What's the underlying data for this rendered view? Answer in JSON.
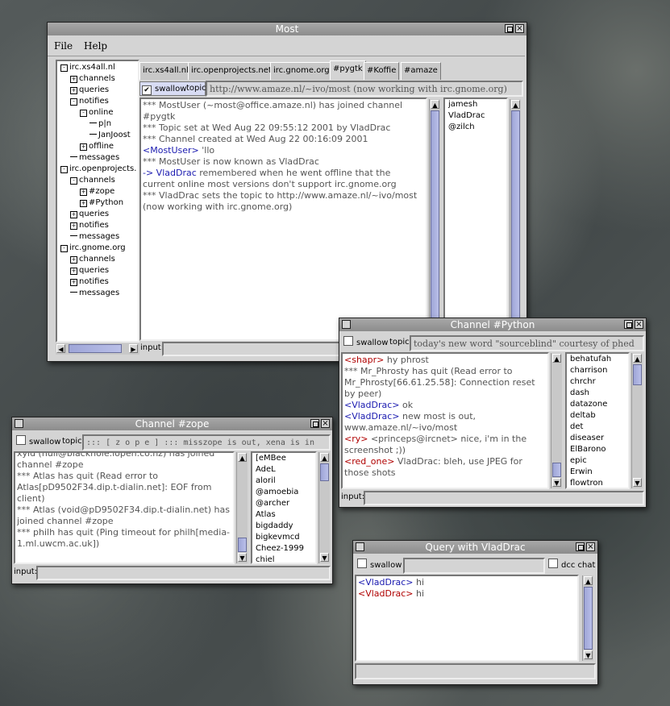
{
  "main": {
    "title": "Most",
    "menu": [
      "File",
      "Help"
    ],
    "tree": [
      {
        "label": "irc.xs4all.nl",
        "level": 0,
        "exp": "-"
      },
      {
        "label": "channels",
        "level": 1,
        "exp": "+"
      },
      {
        "label": "queries",
        "level": 1,
        "exp": "+"
      },
      {
        "label": "notifies",
        "level": 1,
        "exp": "-"
      },
      {
        "label": "online",
        "level": 2,
        "exp": "-"
      },
      {
        "label": "p|n",
        "level": 3,
        "exp": ""
      },
      {
        "label": "JanJoost",
        "level": 3,
        "exp": ""
      },
      {
        "label": "offline",
        "level": 2,
        "exp": "+"
      },
      {
        "label": "messages",
        "level": 1,
        "exp": ""
      },
      {
        "label": "irc.openprojects.",
        "level": 0,
        "exp": "-"
      },
      {
        "label": "channels",
        "level": 1,
        "exp": "-"
      },
      {
        "label": "#zope",
        "level": 2,
        "exp": "+"
      },
      {
        "label": "#Python",
        "level": 2,
        "exp": "+"
      },
      {
        "label": "queries",
        "level": 1,
        "exp": "+"
      },
      {
        "label": "notifies",
        "level": 1,
        "exp": "+"
      },
      {
        "label": "messages",
        "level": 1,
        "exp": ""
      },
      {
        "label": "irc.gnome.org",
        "level": 0,
        "exp": "-"
      },
      {
        "label": "channels",
        "level": 1,
        "exp": "+"
      },
      {
        "label": "queries",
        "level": 1,
        "exp": "+"
      },
      {
        "label": "notifies",
        "level": 1,
        "exp": "+"
      },
      {
        "label": "messages",
        "level": 1,
        "exp": ""
      }
    ],
    "tabs": [
      "irc.xs4all.nl",
      "irc.openprojects.net",
      "irc.gnome.org",
      "#pygtk",
      "#Koffie",
      "#amaze"
    ],
    "swallow_label": "swallow",
    "topic_label": "topic",
    "topic": "http://www.amaze.nl/~ivo/most (now working with irc.gnome.org)",
    "log": [
      [
        {
          "c": "g",
          "t": "*** MostUser (~most@office.amaze.nl) has joined channel #pygtk"
        }
      ],
      [
        {
          "c": "g",
          "t": "*** Topic set at Wed Aug 22 09:55:12 2001 by VladDrac"
        }
      ],
      [
        {
          "c": "g",
          "t": "*** Channel created at Wed Aug 22 00:16:09 2001"
        }
      ],
      [
        {
          "c": "n",
          "t": "<MostUser>"
        },
        {
          "c": "g",
          "t": " 'llo"
        }
      ],
      [
        {
          "c": "g",
          "t": "*** MostUser is now known as VladDrac"
        }
      ],
      [
        {
          "c": "n",
          "t": "-> VladDrac"
        },
        {
          "c": "g",
          "t": " remembered when he went offline that the current online most versions don't support irc.gnome.org"
        }
      ],
      [
        {
          "c": "g",
          "t": "*** VladDrac sets the topic to http://www.amaze.nl/~ivo/most (now working with irc.gnome.org)"
        }
      ]
    ],
    "nicks": [
      "jamesh",
      "VladDrac",
      "@zilch"
    ],
    "input_label": "input:"
  },
  "python": {
    "title": "Channel #Python",
    "swallow_label": "swallow",
    "topic_label": "topic",
    "topic": "today's new word \"sourceblind\" courtesy of phed",
    "log": [
      [
        {
          "c": "r",
          "t": "<shapr>"
        },
        {
          "c": "g",
          "t": " hy phrost"
        }
      ],
      [
        {
          "c": "g",
          "t": "*** Mr_Phrosty has quit (Read error to Mr_Phrosty[66.61.25.58]: Connection reset by peer)"
        }
      ],
      [
        {
          "c": "n",
          "t": "<VladDrac>"
        },
        {
          "c": "g",
          "t": " ok"
        }
      ],
      [
        {
          "c": "n",
          "t": "<VladDrac>"
        },
        {
          "c": "g",
          "t": " new most is out, www.amaze.nl/~ivo/most"
        }
      ],
      [
        {
          "c": "r",
          "t": "<ry>"
        },
        {
          "c": "g",
          "t": " <princeps@ircnet> nice, i'm in the screenshot ;))"
        }
      ],
      [
        {
          "c": "r",
          "t": "<red_one>"
        },
        {
          "c": "g",
          "t": " VladDrac: bleh, use JPEG for those shots"
        }
      ]
    ],
    "nicks": [
      "behatufah",
      "charrison",
      "chrchr",
      "dash",
      "datazone",
      "deltab",
      "det",
      "diseaser",
      "ElBarono",
      "epic",
      "Erwin",
      "flowtron"
    ],
    "input_label": "input:"
  },
  "zope": {
    "title": "Channel #zope",
    "swallow_label": "swallow",
    "topic_label": "topic",
    "topic": "::: [ z o p e ] ::: misszope is out, xena is in",
    "log_first": "xyid (null@blackhole.lopen.co.nz) has joined channel #zope",
    "log": [
      [
        {
          "c": "g",
          "t": "*** Atlas has quit (Read error to Atlas[pD9502F34.dip.t-dialin.net]: EOF from client)"
        }
      ],
      [
        {
          "c": "g",
          "t": "*** Atlas (void@pD9502F34.dip.t-dialin.net) has joined channel #zope"
        }
      ],
      [
        {
          "c": "g",
          "t": "*** philh has quit (Ping timeout for philh[media-1.ml.uwcm.ac.uk])"
        }
      ]
    ],
    "nicks": [
      "[eMBee",
      "AdeL",
      "aloril",
      "@amoebia",
      "@archer",
      "Atlas",
      "bigdaddy",
      "bigkevmcd",
      "Cheez-1999",
      "chiel"
    ],
    "input_label": "input:"
  },
  "query": {
    "title": "Query with VladDrac",
    "swallow_label": "swallow",
    "dcc_label": "dcc chat",
    "log": [
      [
        {
          "c": "n",
          "t": "<VladDrac>"
        },
        {
          "c": "g",
          "t": " hi"
        }
      ],
      [
        {
          "c": "r",
          "t": "<VladDrac>"
        },
        {
          "c": "g",
          "t": " hi"
        }
      ]
    ]
  }
}
